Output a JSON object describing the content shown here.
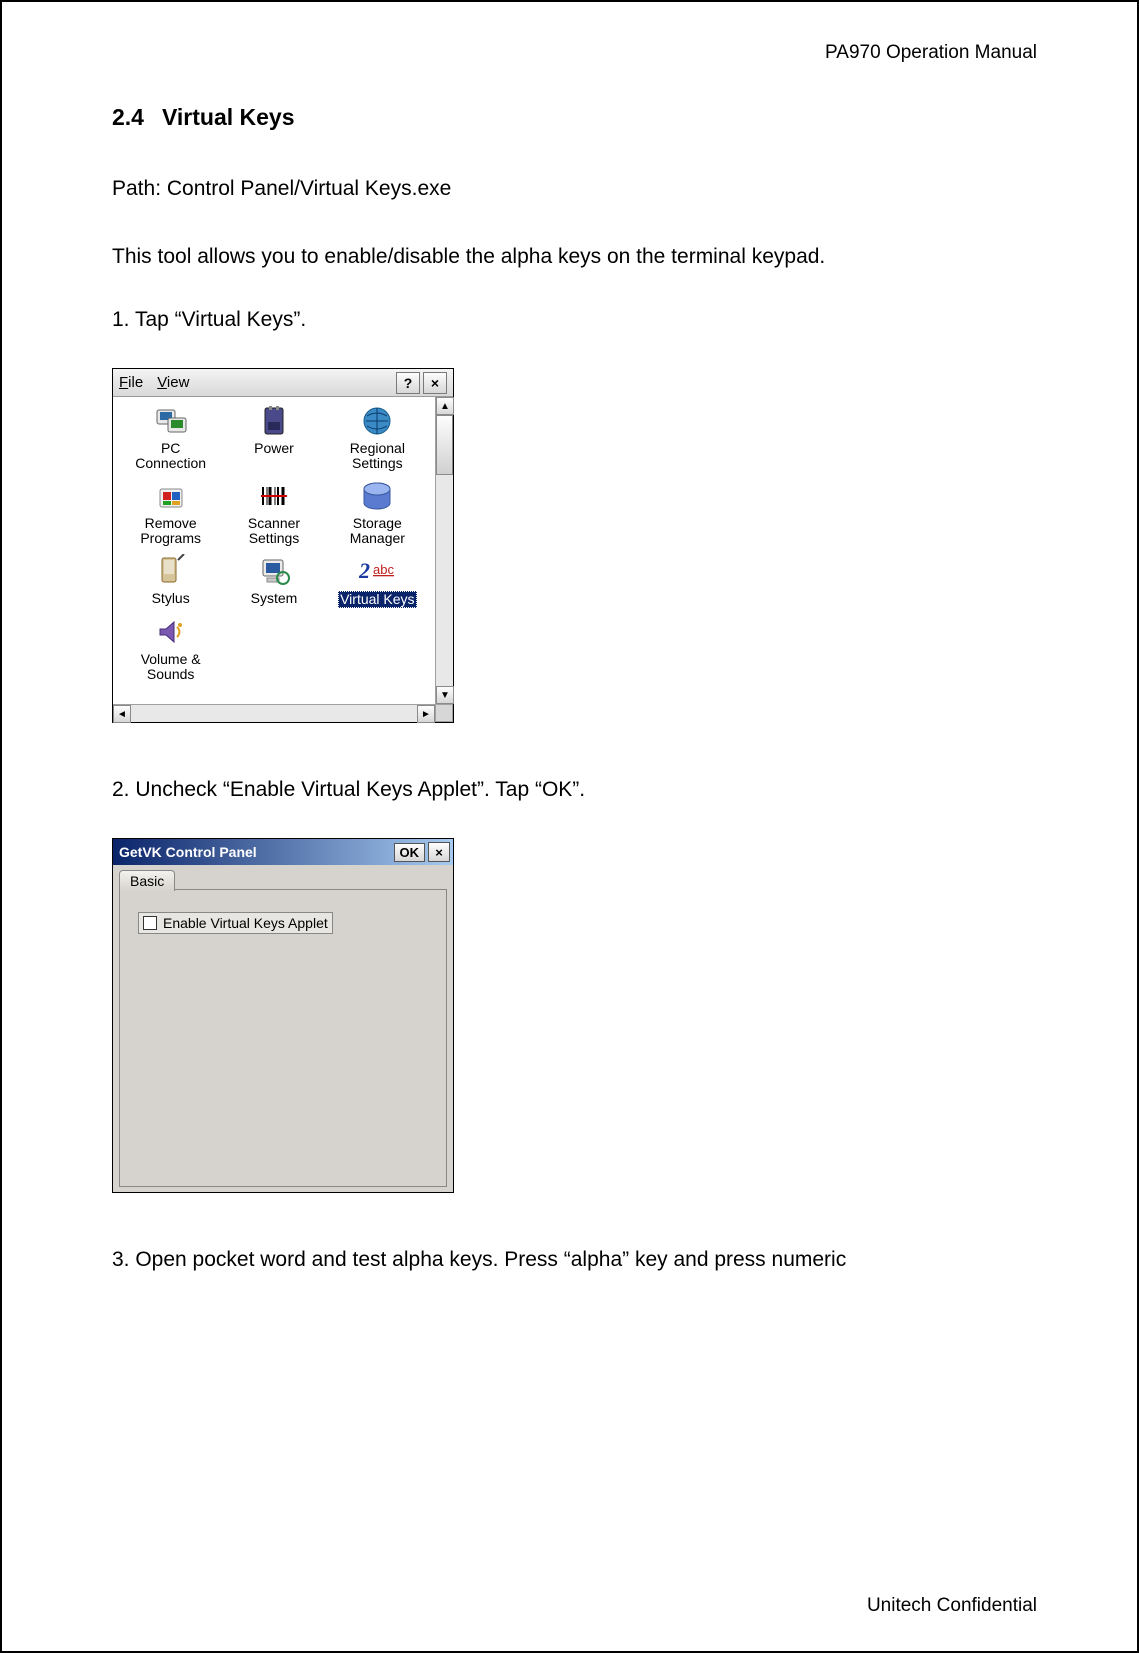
{
  "header": {
    "doc_title": "PA970 Operation Manual"
  },
  "section": {
    "number": "2.4",
    "title": "Virtual Keys"
  },
  "body": {
    "path_line": "Path: Control Panel/Virtual Keys.exe",
    "intro": "This tool allows you to enable/disable the alpha keys on the terminal keypad.",
    "step1": "1. Tap “Virtual Keys”.",
    "step2": "2. Uncheck “Enable Virtual Keys Applet”. Tap “OK”.",
    "step3": "3. Open pocket word and test alpha keys. Press “alpha” key and press numeric"
  },
  "shot1": {
    "menu": {
      "file": "File",
      "view": "View",
      "help": "?",
      "close": "×"
    },
    "items": [
      {
        "label": "PC\nConnection",
        "name": "pc-connection-icon",
        "color": "#2b6aa5"
      },
      {
        "label": "Power",
        "name": "power-icon",
        "color": "#3a3a7a"
      },
      {
        "label": "Regional\nSettings",
        "name": "regional-settings-icon",
        "color": "#1f6aa7"
      },
      {
        "label": "Remove\nPrograms",
        "name": "remove-programs-icon",
        "color": "#c02020"
      },
      {
        "label": "Scanner\nSettings",
        "name": "scanner-settings-icon",
        "color": "#000000"
      },
      {
        "label": "Storage\nManager",
        "name": "storage-manager-icon",
        "color": "#5a7bd0"
      },
      {
        "label": "Stylus",
        "name": "stylus-icon",
        "color": "#b08a4a"
      },
      {
        "label": "System",
        "name": "system-icon",
        "color": "#2a5aa0"
      },
      {
        "label": "Virtual Keys",
        "name": "virtual-keys-icon",
        "color": "#1a3aa0",
        "selected": true
      },
      {
        "label": "Volume &\nSounds",
        "name": "volume-sounds-icon",
        "color": "#6a4a9a"
      }
    ]
  },
  "shot2": {
    "title": "GetVK Control Panel",
    "ok": "OK",
    "close": "×",
    "tab": "Basic",
    "checkbox_label": "Enable Virtual Keys Applet"
  },
  "footer": {
    "confidential": "Unitech Confidential"
  }
}
